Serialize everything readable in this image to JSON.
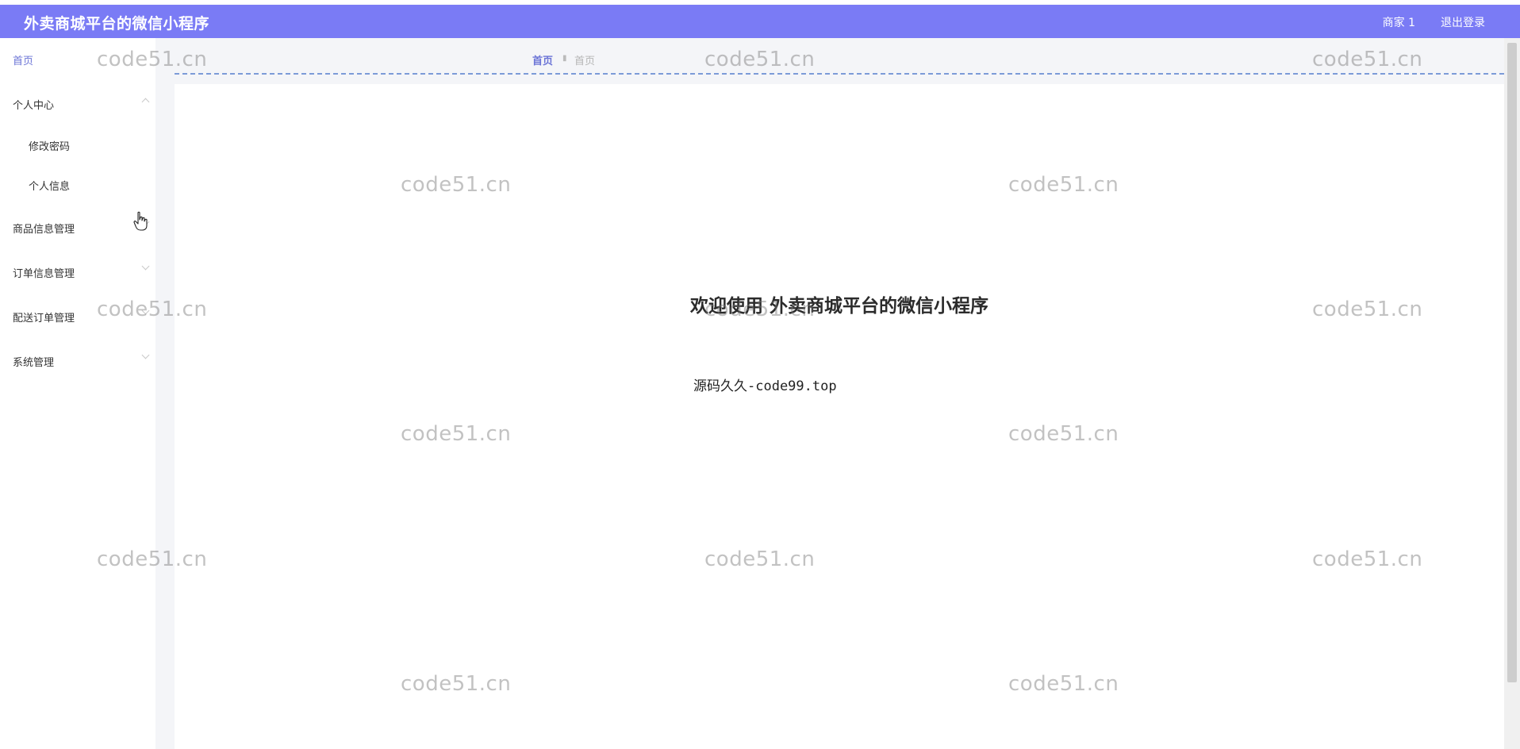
{
  "header": {
    "app_title": "外卖商城平台的微信小程序",
    "user": "商家 1",
    "logout": "退出登录",
    "bg_color": "#7a7bf5"
  },
  "sidebar": {
    "items": [
      {
        "label": "首页",
        "active": true
      },
      {
        "label": "个人中心",
        "expanded": true
      },
      {
        "label": "修改密码",
        "sub": true
      },
      {
        "label": "个人信息",
        "sub": true
      },
      {
        "label": "商品信息管理"
      },
      {
        "label": "订单信息管理"
      },
      {
        "label": "配送订单管理"
      },
      {
        "label": "系统管理"
      }
    ]
  },
  "breadcrumb": {
    "home": "首页",
    "current": "首页"
  },
  "main": {
    "welcome": "欢迎使用 外卖商城平台的微信小程序",
    "source": "源码久久-code99.top"
  },
  "watermark": "code51.cn",
  "icons": {
    "cursor": "hand-pointer-icon",
    "chevron": "chevron-icon"
  }
}
